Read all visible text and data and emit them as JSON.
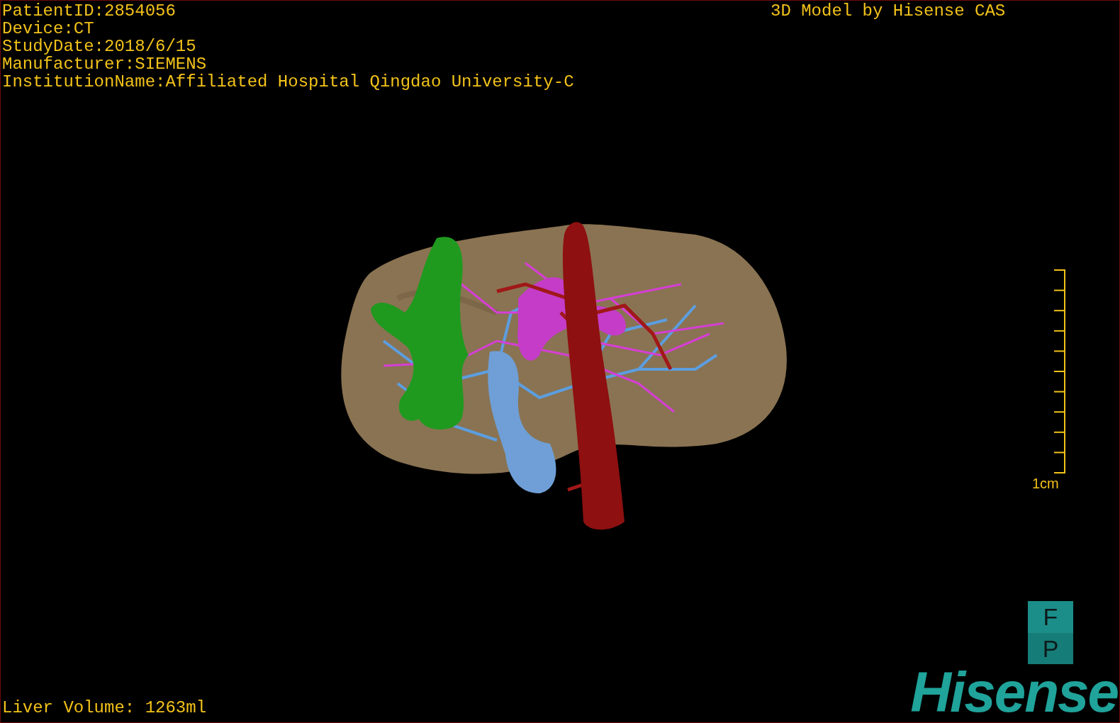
{
  "info_lines": [
    "PatientID:2854056",
    "Device:CT",
    "StudyDate:2018/6/15",
    "Manufacturer:SIEMENS",
    "InstitutionName:Affiliated Hospital Qingdao University-C"
  ],
  "caption": "3D Model by Hisense CAS",
  "scale_bar": {
    "label": "1cm"
  },
  "orientation_cube": {
    "top": "F",
    "bottom": "P"
  },
  "logo": "Hisense",
  "liver_volume": "Liver Volume: 1263ml"
}
